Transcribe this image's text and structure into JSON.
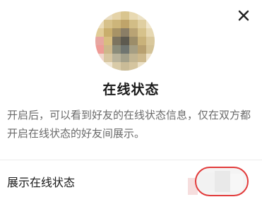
{
  "dialog": {
    "close_icon": "close-icon",
    "title": "在线状态",
    "description": "开启后，可以看到好友的在线状态信息，仅在双方都开启在线状态的好友间展示。",
    "setting": {
      "label": "展示在线状态",
      "toggle_on": false
    }
  },
  "colors": {
    "title": "#1a1a1a",
    "description": "#6a6a6a",
    "highlight_border": "#e23b3b"
  },
  "avatar_pixels": [
    "#ffffff",
    "#e9dcc0",
    "#e5d3a8",
    "#d9c58f",
    "#e8d9b2",
    "#ece2c6",
    "#ffffff",
    "#ebdcb9",
    "#d7c18a",
    "#cdb57a",
    "#bfa46a",
    "#d2bd86",
    "#e0cfa1",
    "#f0e6cc",
    "#e1cc97",
    "#c9ae6d",
    "#a89366",
    "#8a7e66",
    "#b9a374",
    "#d6c28b",
    "#e6d8b2",
    "#e7a6a0",
    "#d8bd80",
    "#7d745f",
    "#5d5a4f",
    "#9c8d69",
    "#c9b27a",
    "#d9c89c",
    "#ee9b96",
    "#cdb78a",
    "#8b8c7a",
    "#6f7570",
    "#a59e83",
    "#b8a070",
    "#d3c296",
    "#f0d6cc",
    "#d8c7a2",
    "#b9b39b",
    "#a3a08a",
    "#c2b592",
    "#cdb98d",
    "#efe4cc",
    "#ffffff",
    "#efe6d2",
    "#d9cba8",
    "#c9bb97",
    "#d5c59f",
    "#ece1c7",
    "#ffffff"
  ]
}
